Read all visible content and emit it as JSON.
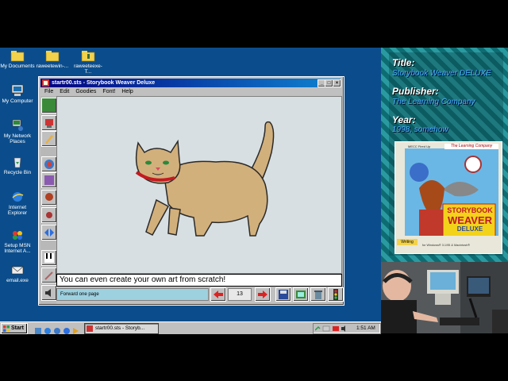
{
  "desktop": {
    "icons": [
      {
        "label": "My Documents",
        "icon": "folder-icon"
      },
      {
        "label": "raweetewin-...",
        "icon": "folder-icon"
      },
      {
        "label": "raweeteexe-T...",
        "icon": "folder-icon"
      },
      {
        "label": "My Computer",
        "icon": "computer-icon"
      },
      {
        "label": "My Network Places",
        "icon": "network-icon"
      },
      {
        "label": "Recycle Bin",
        "icon": "recycle-bin-icon"
      },
      {
        "label": "Internet Explorer",
        "icon": "ie-icon"
      },
      {
        "label": "Setup MSN Internet A...",
        "icon": "msn-icon"
      },
      {
        "label": "email.exe",
        "icon": "email-icon"
      }
    ]
  },
  "window": {
    "title": "startr00.sts - Storybook Weaver Deluxe",
    "menu": [
      "File",
      "Edit",
      "Goodies",
      "Font!",
      "Help"
    ],
    "story_text": "You can even create your own art from scratch!",
    "status_text": "Forward one page",
    "page_number": "13"
  },
  "taskbar": {
    "start_label": "Start",
    "task_label": "startr00.sts - Storyb...",
    "clock": "1:51 AM"
  },
  "panel": {
    "title_label": "Title:",
    "title_value": "Storybook Weaver DELUXE",
    "publisher_label": "Publisher:",
    "publisher_value": "The Learning Company",
    "year_label": "Year:",
    "year_value": "1998, somehow",
    "box": {
      "top_left": "MECC Fired Up",
      "brand": "The Learning Company",
      "logo_line1": "STORYBOOK",
      "logo_line2": "WEAVER",
      "logo_line3": "DELUXE",
      "category": "Writing",
      "platform": "for Windows® 3.1/95 & Macintosh®"
    }
  }
}
